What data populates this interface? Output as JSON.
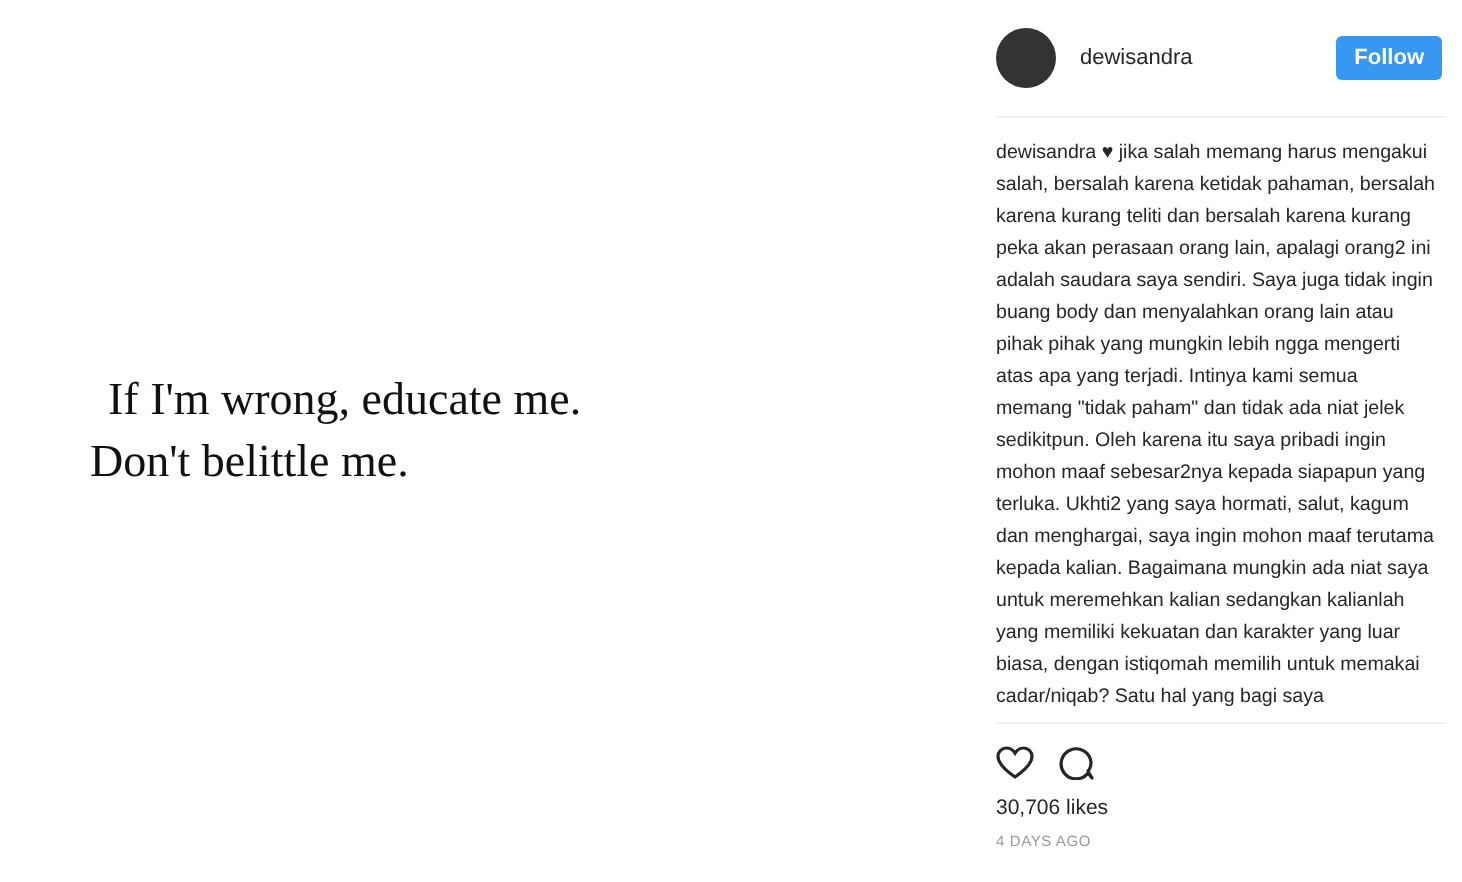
{
  "post_image": {
    "quote_lines": [
      "If I'm wrong, educate me.",
      "Don't belittle me."
    ]
  },
  "header": {
    "username": "dewisandra",
    "follow_button": "Follow"
  },
  "caption": {
    "username": "dewisandra",
    "text": "♥ jika salah memang harus mengakui salah, bersalah karena ketidak pahaman, bersalah karena kurang teliti dan bersalah karena kurang peka akan perasaan orang lain, apalagi orang2 ini adalah saudara saya sendiri. Saya juga tidak ingin buang body dan menyalahkan orang lain atau pihak pihak yang mungkin lebih ngga mengerti atas apa yang terjadi. Intinya kami semua memang \"tidak paham\" dan tidak ada niat jelek sedikitpun. Oleh karena itu saya pribadi ingin mohon maaf sebesar2nya kepada siapapun yang terluka. Ukhti2 yang saya hormati, salut, kagum dan menghargai, saya ingin mohon maaf terutama kepada kalian. Bagaimana mungkin ada niat saya untuk meremehkan kalian sedangkan kalianlah yang memiliki kekuatan dan karakter yang luar biasa, dengan istiqomah memilih untuk memakai cadar/niqab? Satu hal yang bagi saya"
  },
  "likes": "30,706 likes",
  "time": "4 DAYS AGO"
}
